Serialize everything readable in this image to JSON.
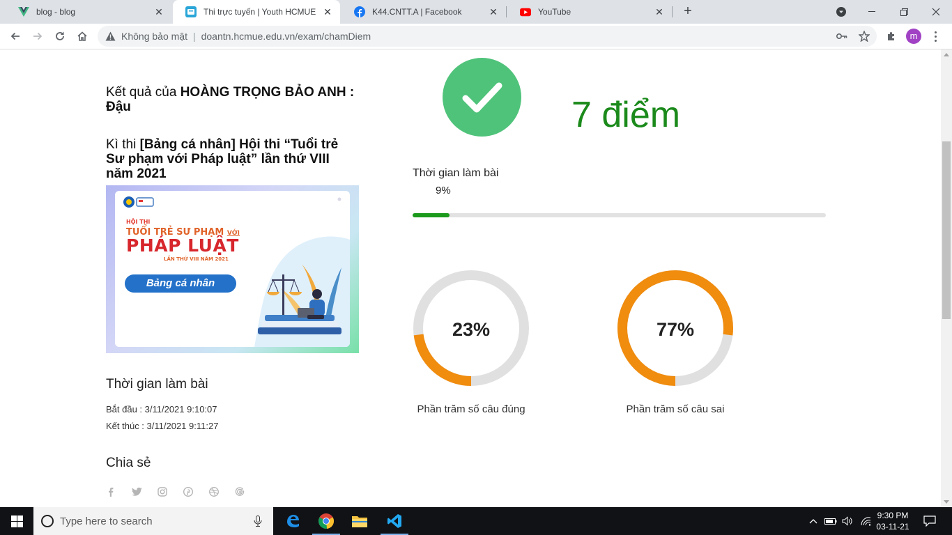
{
  "browser": {
    "tabs": [
      {
        "title": "blog - blog",
        "icon": "vuejs-logo-icon",
        "active": false
      },
      {
        "title": "Thi trực tuyến | Youth HCMUE",
        "icon": "youth-hcmue-icon",
        "active": true
      },
      {
        "title": "K44.CNTT.A | Facebook",
        "icon": "facebook-icon",
        "active": false
      },
      {
        "title": "YouTube",
        "icon": "youtube-icon",
        "active": false
      }
    ],
    "insecure_label": "Không bảo mật",
    "url": "doantn.hcmue.edu.vn/exam/chamDiem",
    "profile_initial": "m"
  },
  "result": {
    "prefix": "Kết quả của ",
    "name": "HOÀNG TRỌNG BẢO ANH : Đậu",
    "exam_prefix": "Kì thi ",
    "exam_name": "[Bảng cá nhân] Hội thi “Tuổi trẻ Sư phạm với Pháp luật” lần thứ VIII năm 2021",
    "score": "7 điểm",
    "time_label": "Thời gian làm bài",
    "time_percent_text": "9%",
    "time_percent": 9,
    "correct": {
      "value": 23,
      "text": "23%",
      "caption": "Phần trăm số câu đúng"
    },
    "wrong": {
      "value": 77,
      "text": "77%",
      "caption": "Phần trăm số câu sai"
    }
  },
  "banner": {
    "line1": "HỘI THI",
    "line2": "TUỔI TRẺ SƯ PHẠM",
    "line2b": "VỚI",
    "line3": "PHÁP LUẬT",
    "line4": "LẦN THỨ VIII NĂM 2021",
    "button": "Bảng cá nhân"
  },
  "timing": {
    "heading": "Thời gian làm bài",
    "start": "Bắt đầu : 3/11/2021 9:10:07",
    "end": "Kết thúc : 3/11/2021 9:11:27"
  },
  "share": {
    "heading": "Chia sẻ",
    "icons": [
      "facebook-icon",
      "twitter-icon",
      "instagram-icon",
      "pinterest-icon",
      "dribbble-icon",
      "google-icon"
    ]
  },
  "taskbar": {
    "search_placeholder": "Type here to search",
    "time": "9:30 PM",
    "date": "03-11-21"
  },
  "colors": {
    "pass_green": "#4fc37a",
    "score_green": "#1b8a1b",
    "donut_orange": "#f08c0e",
    "donut_track": "#e0e0e0"
  }
}
